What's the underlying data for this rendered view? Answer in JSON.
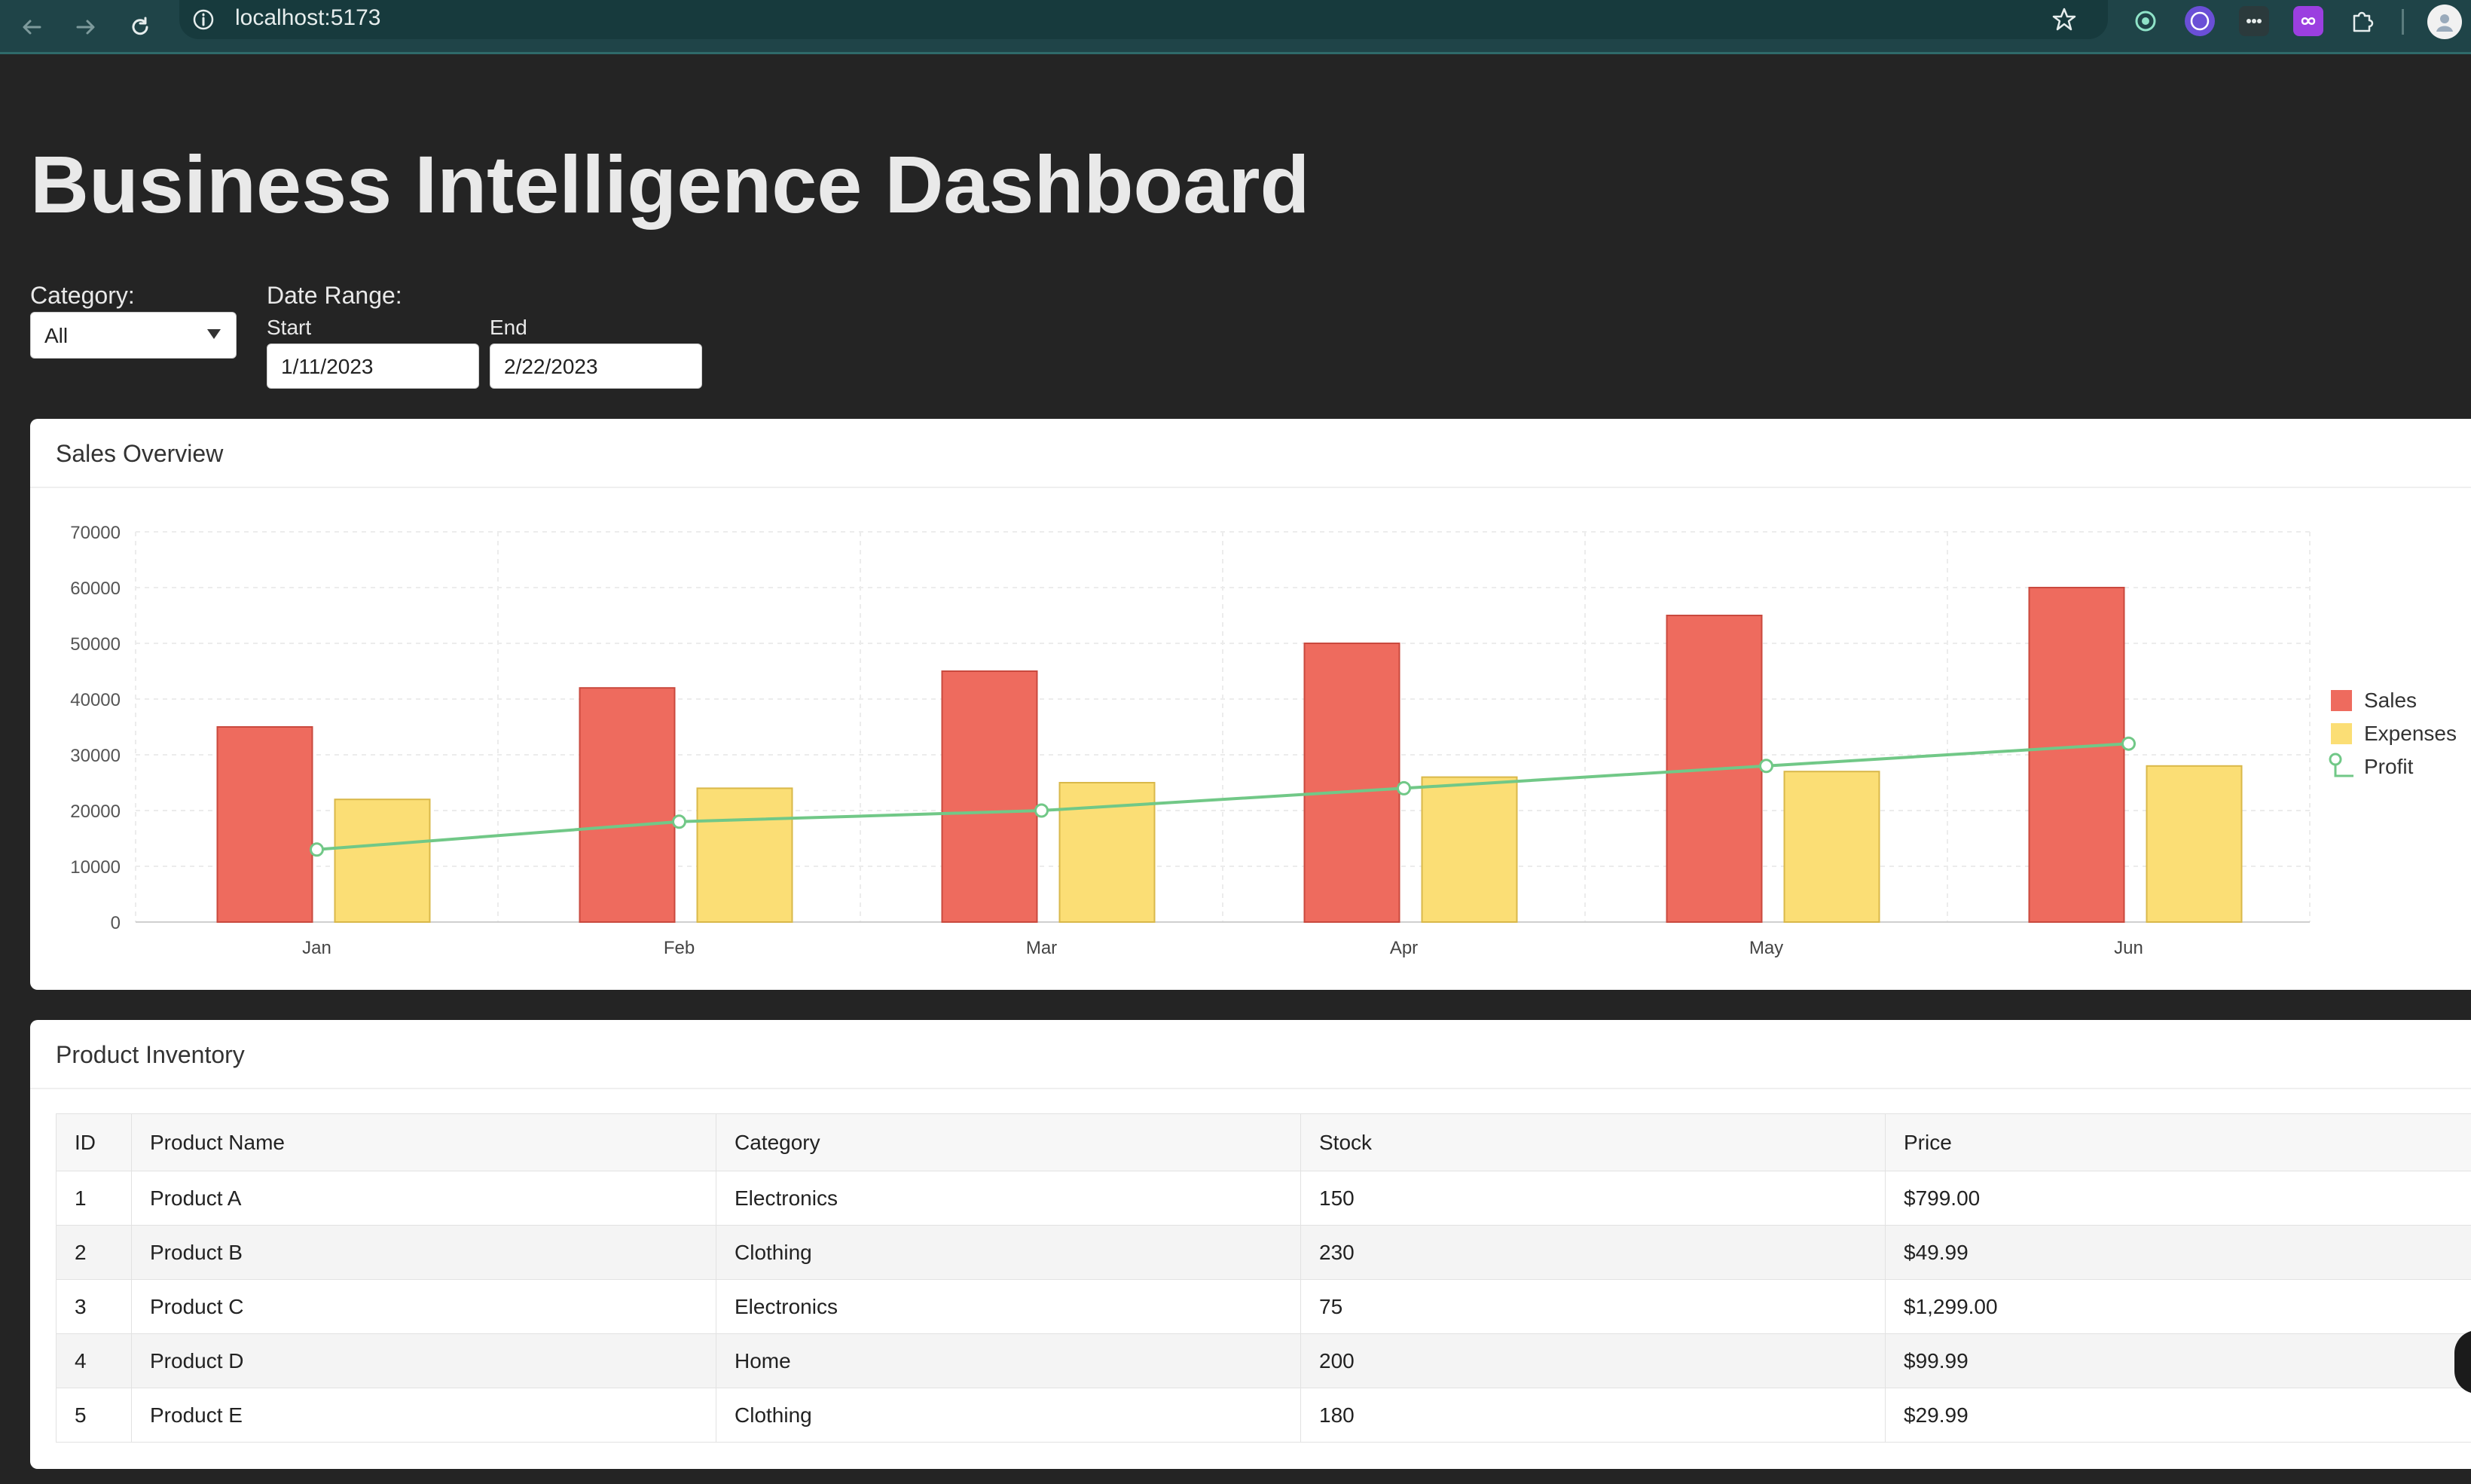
{
  "browser": {
    "url": "localhost:5173",
    "accent_color": "#1f4448"
  },
  "header": {
    "title": "Business Intelligence Dashboard"
  },
  "filters": {
    "category_label": "Category:",
    "category_value": "All",
    "date_range_label": "Date Range:",
    "start_label": "Start",
    "start_value": "1/11/2023",
    "end_label": "End",
    "end_value": "2/22/2023"
  },
  "sales_card": {
    "title": "Sales Overview"
  },
  "chart_data": {
    "type": "bar",
    "categories": [
      "Jan",
      "Feb",
      "Mar",
      "Apr",
      "May",
      "Jun"
    ],
    "series": [
      {
        "name": "Sales",
        "type": "bar",
        "color": "#ee6b5e",
        "values": [
          35000,
          42000,
          45000,
          50000,
          55000,
          60000
        ]
      },
      {
        "name": "Expenses",
        "type": "bar",
        "color": "#fbde75",
        "values": [
          22000,
          24000,
          25000,
          26000,
          27000,
          28000
        ]
      },
      {
        "name": "Profit",
        "type": "line",
        "color": "#71c887",
        "values": [
          13000,
          18000,
          20000,
          24000,
          28000,
          32000
        ]
      }
    ],
    "yticks": [
      "0",
      "10000",
      "20000",
      "30000",
      "40000",
      "50000",
      "60000",
      "70000"
    ],
    "ylim": [
      0,
      70000
    ],
    "grid": true,
    "legend_position": "right"
  },
  "inventory_card": {
    "title": "Product Inventory",
    "columns": [
      "ID",
      "Product Name",
      "Category",
      "Stock",
      "Price"
    ],
    "rows": [
      {
        "id": "1",
        "name": "Product A",
        "category": "Electronics",
        "stock": "150",
        "price": "$799.00"
      },
      {
        "id": "2",
        "name": "Product B",
        "category": "Clothing",
        "stock": "230",
        "price": "$49.99"
      },
      {
        "id": "3",
        "name": "Product C",
        "category": "Electronics",
        "stock": "75",
        "price": "$1,299.00"
      },
      {
        "id": "4",
        "name": "Product D",
        "category": "Home",
        "stock": "200",
        "price": "$99.99"
      },
      {
        "id": "5",
        "name": "Product E",
        "category": "Clothing",
        "stock": "180",
        "price": "$29.99"
      }
    ]
  }
}
